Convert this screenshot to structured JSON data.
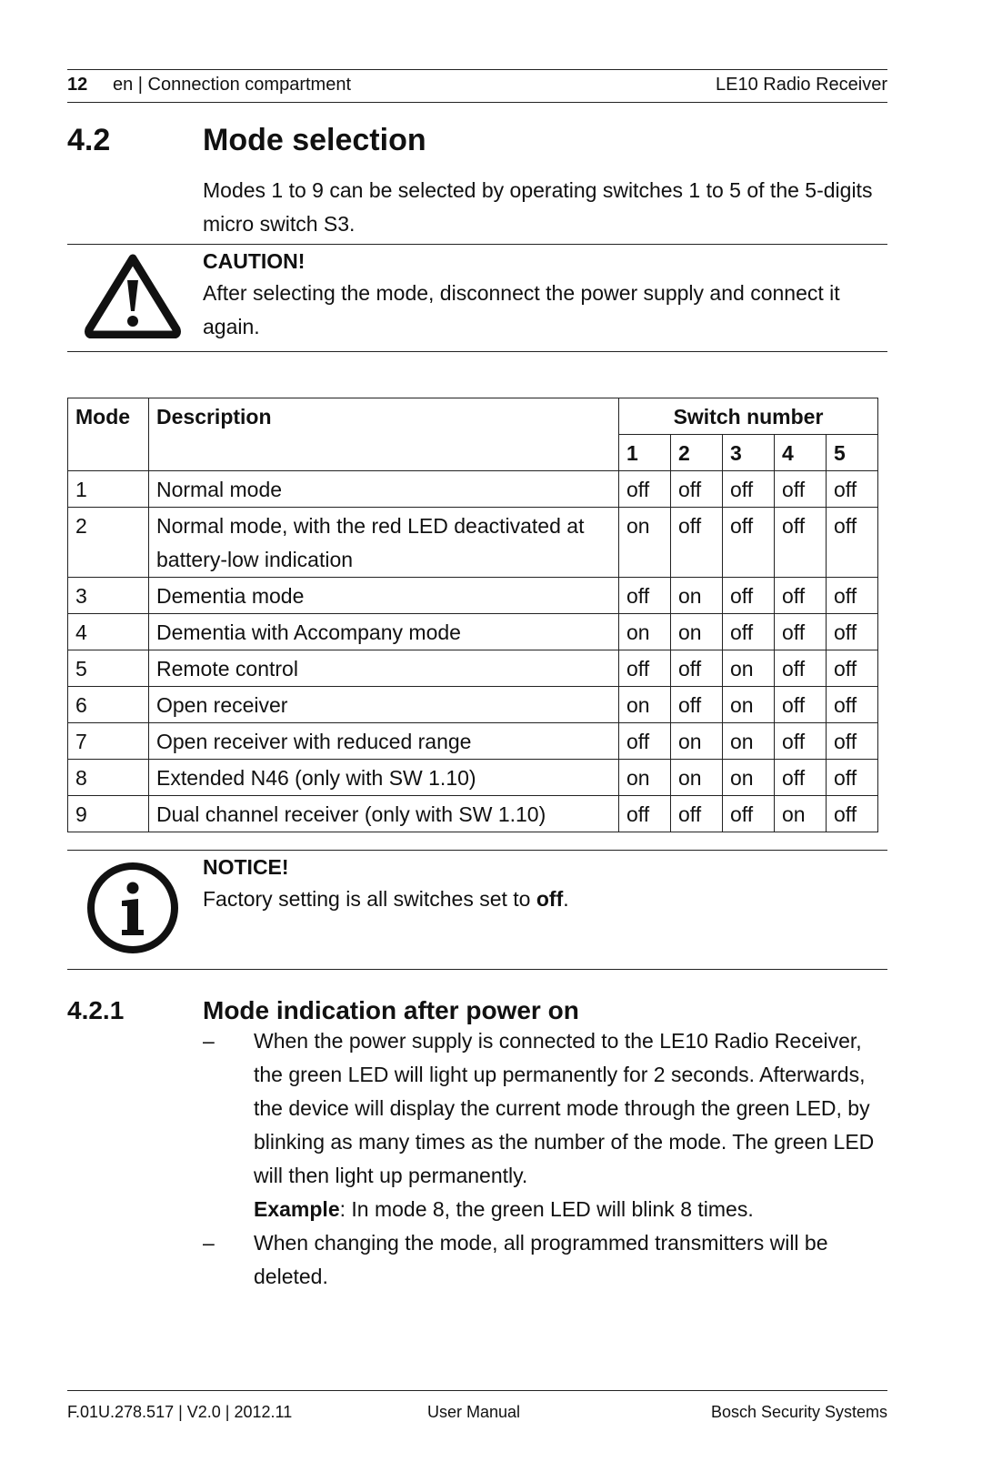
{
  "header": {
    "page_number": "12",
    "section": "en | Connection compartment",
    "product": "LE10 Radio Receiver"
  },
  "section_4_2": {
    "number": "4.2",
    "title": "Mode selection",
    "intro": "Modes 1 to 9 can be selected by operating switches 1 to 5 of the 5-digits micro switch S3."
  },
  "caution": {
    "icon": "warning-triangle-icon",
    "title": "CAUTION!",
    "text": "After selecting the mode, disconnect the power supply and connect it again."
  },
  "table": {
    "headers": {
      "mode": "Mode",
      "description": "Description",
      "switch_group": "Switch number",
      "switches": [
        "1",
        "2",
        "3",
        "4",
        "5"
      ]
    },
    "rows": [
      {
        "mode": "1",
        "description": "Normal mode",
        "switches": [
          "off",
          "off",
          "off",
          "off",
          "off"
        ]
      },
      {
        "mode": "2",
        "description": "Normal mode, with the red LED deactivated at battery-low indication",
        "switches": [
          "on",
          "off",
          "off",
          "off",
          "off"
        ]
      },
      {
        "mode": "3",
        "description": "Dementia mode",
        "switches": [
          "off",
          "on",
          "off",
          "off",
          "off"
        ]
      },
      {
        "mode": "4",
        "description": "Dementia with Accompany mode",
        "switches": [
          "on",
          "on",
          "off",
          "off",
          "off"
        ]
      },
      {
        "mode": "5",
        "description": "Remote control",
        "switches": [
          "off",
          "off",
          "on",
          "off",
          "off"
        ]
      },
      {
        "mode": "6",
        "description": "Open receiver",
        "switches": [
          "on",
          "off",
          "on",
          "off",
          "off"
        ]
      },
      {
        "mode": "7",
        "description": "Open receiver with reduced range",
        "switches": [
          "off",
          "on",
          "on",
          "off",
          "off"
        ]
      },
      {
        "mode": "8",
        "description": "Extended N46 (only with SW 1.10)",
        "switches": [
          "on",
          "on",
          "on",
          "off",
          "off"
        ]
      },
      {
        "mode": "9",
        "description": "Dual channel receiver (only with SW 1.10)",
        "switches": [
          "off",
          "off",
          "off",
          "on",
          "off"
        ]
      }
    ]
  },
  "notice": {
    "icon": "info-icon",
    "title": "NOTICE!",
    "text_before": "Factory setting is all switches set to ",
    "text_bold": "off",
    "text_after": "."
  },
  "section_4_2_1": {
    "number": "4.2.1",
    "title": "Mode indication after power on",
    "bullet_marker": "–",
    "items": [
      {
        "text": "When the power supply is connected to the LE10 Radio Receiver, the green LED will light up permanently for 2 seconds. Afterwards, the device will display the current mode through the green LED, by blinking as many times as the number of the mode. The green LED will then light up permanently.",
        "example_label": "Example",
        "example_text": ": In mode 8, the green LED will blink 8 times."
      },
      {
        "text": "When changing the mode, all programmed transmitters will be deleted."
      }
    ]
  },
  "footer": {
    "doc_id": "F.01U.278.517 | V2.0 | 2012.11",
    "doc_type": "User Manual",
    "company": "Bosch Security Systems"
  }
}
